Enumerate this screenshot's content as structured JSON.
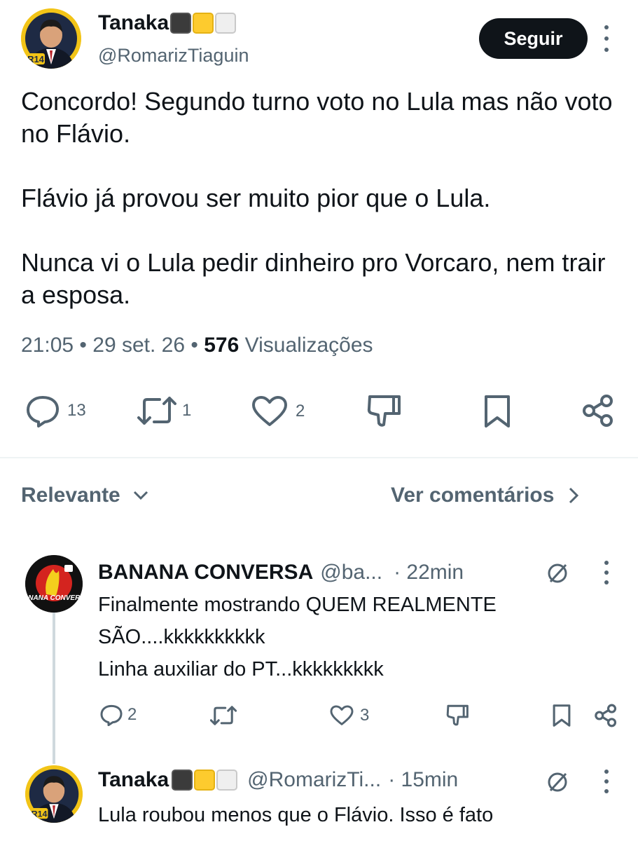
{
  "main_tweet": {
    "author_name": "Tanaka",
    "author_handle": "@RomarizTiaguin",
    "follow_label": "Seguir",
    "body": [
      "Concordo! Segundo turno voto no Lula mas não voto no Flávio.",
      "Flávio já provou ser muito pior que o Lula.",
      "Nunca vi o Lula pedir dinheiro pro Vorcaro, nem trair a esposa."
    ],
    "time": "21:05",
    "date": "29 set. 26",
    "separator": "•",
    "views_count": "576",
    "views_label": "Visualizações",
    "actions": {
      "replies": "13",
      "reposts": "1",
      "likes": "2"
    }
  },
  "sort": {
    "label": "Relevante",
    "see_comments": "Ver comentários"
  },
  "replies": [
    {
      "author_name": "BANANA CONVERSA",
      "author_handle": "@ba...",
      "time": "· 22min",
      "lines": [
        "Finalmente mostrando QUEM REALMENTE",
        "SÃO....kkkkkkkkkk",
        "Linha auxiliar do PT...kkkkkkkkk"
      ],
      "avatar_text": "BANANA CONVERSA",
      "replies": "2",
      "reposts": "",
      "likes": "3"
    },
    {
      "author_name": "Tanaka",
      "author_handle": "@RomarizTi...",
      "time": "· 15min",
      "lines": [
        "Lula roubou menos que o Flávio. Isso é fato"
      ]
    }
  ],
  "avatar_badge": "R14",
  "colors": {
    "text": "#0f1419",
    "secondary": "#536471",
    "button_bg": "#0f1419",
    "avatar_yellow": "#f2c417"
  }
}
